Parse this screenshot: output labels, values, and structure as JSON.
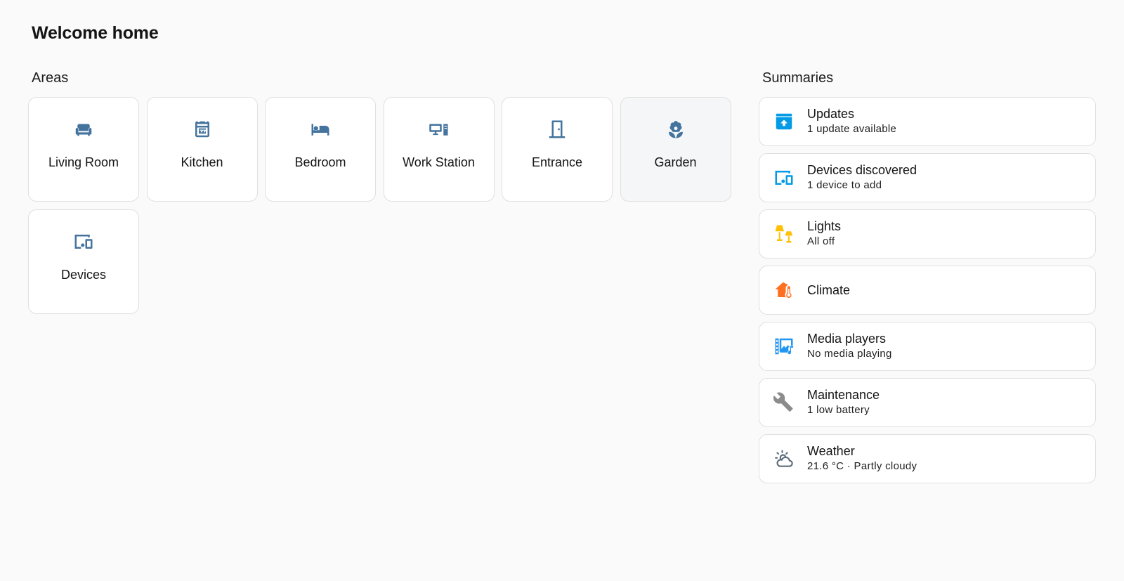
{
  "header": {
    "title": "Welcome home"
  },
  "areas": {
    "title": "Areas",
    "icon_color": "#44739e",
    "items": [
      {
        "label": "Living Room",
        "icon": "sofa-icon"
      },
      {
        "label": "Kitchen",
        "icon": "stove-icon"
      },
      {
        "label": "Bedroom",
        "icon": "bed-icon"
      },
      {
        "label": "Work Station",
        "icon": "desktop-tower-icon"
      },
      {
        "label": "Entrance",
        "icon": "door-icon"
      },
      {
        "label": "Garden",
        "icon": "flower-icon"
      },
      {
        "label": "Devices",
        "icon": "devices-icon"
      }
    ]
  },
  "summaries": {
    "title": "Summaries",
    "items": [
      {
        "title": "Updates",
        "subtitle": "1 update available",
        "icon": "package-up-icon",
        "color": "#039be5"
      },
      {
        "title": "Devices discovered",
        "subtitle": "1 device to add",
        "icon": "devices-icon",
        "color": "#039be5"
      },
      {
        "title": "Lights",
        "subtitle": "All off",
        "icon": "lamps-icon",
        "color": "#ffc107"
      },
      {
        "title": "Climate",
        "subtitle": "",
        "icon": "home-thermometer-icon",
        "color": "#ff6f22"
      },
      {
        "title": "Media players",
        "subtitle": "No media playing",
        "icon": "multimedia-icon",
        "color": "#2196f3"
      },
      {
        "title": "Maintenance",
        "subtitle": "1 low battery",
        "icon": "wrench-icon",
        "color": "#8c8c8c"
      },
      {
        "title": "Weather",
        "subtitle": "21.6 °C · Partly cloudy",
        "icon": "weather-partly-cloudy-icon",
        "color": "#5a6b7b"
      }
    ]
  }
}
